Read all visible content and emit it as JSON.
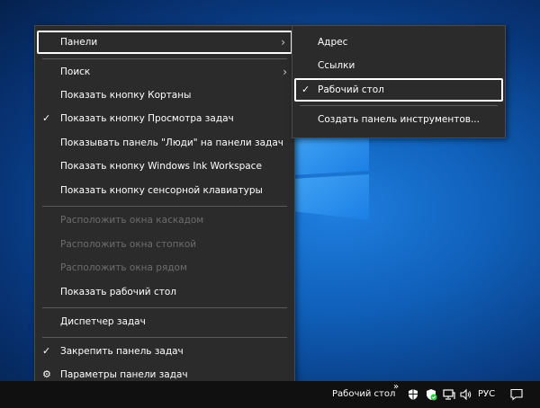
{
  "menu": {
    "items": [
      {
        "label": "Панели",
        "checked": false,
        "disabled": false,
        "submenu": true,
        "highlighted": true
      },
      {
        "label": "Поиск",
        "checked": false,
        "disabled": false,
        "submenu": true
      },
      {
        "label": "Показать кнопку Кортаны",
        "checked": false,
        "disabled": false
      },
      {
        "label": "Показать кнопку Просмотра задач",
        "checked": true,
        "disabled": false
      },
      {
        "label": "Показывать панель \"Люди\" на панели задач",
        "checked": false,
        "disabled": false
      },
      {
        "label": "Показать кнопку Windows Ink Workspace",
        "checked": false,
        "disabled": false
      },
      {
        "label": "Показать кнопку сенсорной клавиатуры",
        "checked": false,
        "disabled": false
      },
      {
        "label": "Расположить окна каскадом",
        "checked": false,
        "disabled": true
      },
      {
        "label": "Расположить окна стопкой",
        "checked": false,
        "disabled": true
      },
      {
        "label": "Расположить окна рядом",
        "checked": false,
        "disabled": true
      },
      {
        "label": "Показать рабочий стол",
        "checked": false,
        "disabled": false
      },
      {
        "label": "Диспетчер задач",
        "checked": false,
        "disabled": false
      },
      {
        "label": "Закрепить панель задач",
        "checked": true,
        "disabled": false
      },
      {
        "label": "Параметры панели задач",
        "icon": "gear-icon",
        "disabled": false
      }
    ]
  },
  "submenu": {
    "items": [
      {
        "label": "Адрес",
        "checked": false
      },
      {
        "label": "Ссылки",
        "checked": false
      },
      {
        "label": "Рабочий стол",
        "checked": true,
        "highlighted": true
      },
      {
        "label": "Создать панель инструментов...",
        "checked": false
      }
    ]
  },
  "taskbar": {
    "toolbar_label": "Рабочий стол",
    "overflow_chevron": "»",
    "language": "РУС",
    "tray_icons": [
      "shield-icon",
      "defender-icon",
      "network-icon",
      "volume-icon"
    ],
    "notification_icon": "action-center-icon"
  },
  "glyphs": {
    "check": "✓",
    "arrow": "›",
    "gear": "⚙"
  },
  "colors": {
    "menu_bg": "#2b2b2b",
    "menu_text": "#ffffff",
    "menu_disabled_text": "#6d6d6d",
    "highlight_outline": "#ffffff",
    "taskbar_bg": "#101010"
  }
}
